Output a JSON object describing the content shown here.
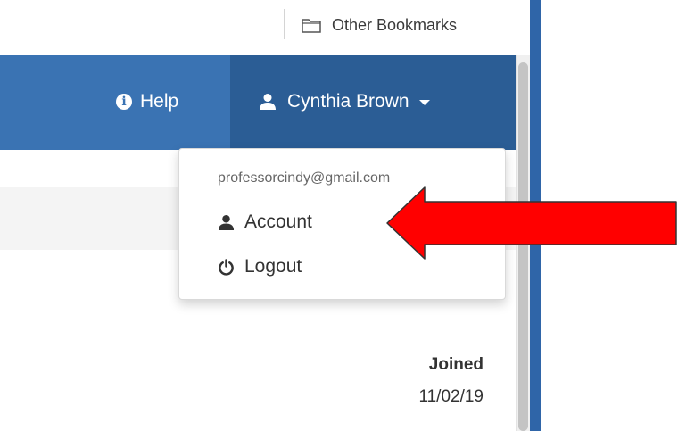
{
  "bookmarks_bar": {
    "other_bookmarks_label": "Other Bookmarks",
    "folder_icon": "folder-icon"
  },
  "navbar": {
    "help_label": "Help",
    "help_icon": "info-circle-icon",
    "user_name": "Cynthia Brown",
    "user_icon": "user-icon",
    "caret_icon": "caret-down-icon",
    "background_color": "#3a73b3",
    "active_color": "#2b5d95"
  },
  "user_dropdown": {
    "email": "professorcindy@gmail.com",
    "items": [
      {
        "label": "Account",
        "icon": "user-icon"
      },
      {
        "label": "Logout",
        "icon": "power-icon"
      }
    ]
  },
  "main": {
    "joined_label": "Joined",
    "joined_value": "11/02/19"
  },
  "annotation": {
    "arrow_color": "#ff0000",
    "arrow_icon": "red-arrow-pointing-left"
  }
}
